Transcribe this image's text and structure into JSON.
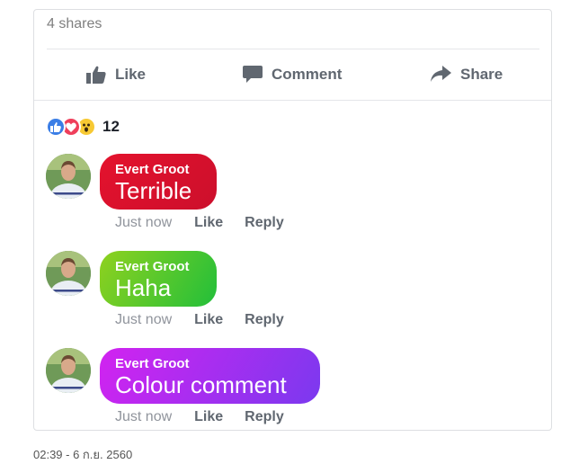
{
  "post": {
    "shares": "4 shares",
    "actions": [
      {
        "label": "Like",
        "icon": "thumbs-up-icon"
      },
      {
        "label": "Comment",
        "icon": "comment-icon"
      },
      {
        "label": "Share",
        "icon": "share-icon"
      }
    ],
    "reactions": {
      "icons": [
        "like-reaction-icon",
        "love-reaction-icon",
        "wow-reaction-icon"
      ],
      "count": "12"
    }
  },
  "comments": [
    {
      "author": "Evert Groot",
      "text": "Terrible",
      "time": "Just now",
      "like": "Like",
      "reply": "Reply",
      "colors": [
        "#e4122d",
        "#cc0f2c"
      ]
    },
    {
      "author": "Evert Groot",
      "text": "Haha",
      "time": "Just now",
      "like": "Like",
      "reply": "Reply",
      "colors": [
        "#8fd11f",
        "#22bf3a"
      ]
    },
    {
      "author": "Evert Groot",
      "text": "Colour comment",
      "time": "Just now",
      "like": "Like",
      "reply": "Reply",
      "colors": [
        "#d223f0",
        "#7b39ef"
      ]
    }
  ],
  "footer": {
    "timestamp": "02:39 - 6 ก.ย. 2560"
  },
  "colors": {
    "text_gray": "#606770",
    "muted": "#90949c",
    "like_blue": "#3b7ee6",
    "love_red": "#ef3f5b",
    "wow_yellow": "#f7c933"
  }
}
